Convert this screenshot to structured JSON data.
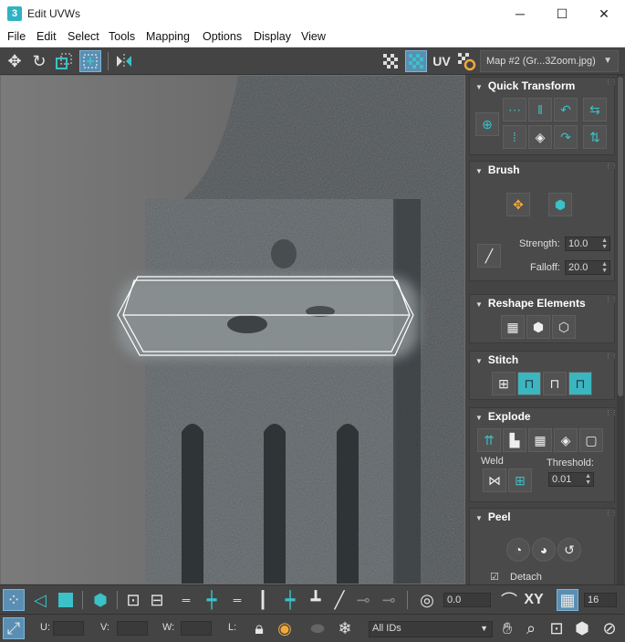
{
  "window": {
    "title": "Edit UVWs",
    "app_icon": "3",
    "minimize": "─",
    "maximize": "☐",
    "close": "✕"
  },
  "menu": [
    "File",
    "Edit",
    "Select",
    "Tools",
    "Mapping",
    "Options",
    "Display",
    "View"
  ],
  "toolbar": {
    "uv_label": "UV",
    "map_select": "Map #2 (Gr...3Zoom.jpg)"
  },
  "quick_transform": {
    "title": "Quick Transform"
  },
  "brush": {
    "title": "Brush",
    "strength_label": "Strength:",
    "strength_value": "10.0",
    "falloff_label": "Falloff:",
    "falloff_value": "20.0"
  },
  "reshape": {
    "title": "Reshape Elements"
  },
  "stitch": {
    "title": "Stitch"
  },
  "explode": {
    "title": "Explode",
    "weld_label": "Weld",
    "threshold_label": "Threshold:",
    "threshold_value": "0.01"
  },
  "peel": {
    "title": "Peel",
    "detach_label": "Detach",
    "detach_checked": true
  },
  "bottom1": {
    "xy_label": "XY",
    "rotate_value": "0.0",
    "grid_value": "16"
  },
  "bottom2": {
    "u_label": "U:",
    "v_label": "V:",
    "w_label": "W:",
    "l_label": "L:",
    "ids_select": "All IDs"
  },
  "colors": {
    "accent": "#3bc1c8",
    "active_blue": "#5a8fb3",
    "panel_bg": "#444444"
  }
}
